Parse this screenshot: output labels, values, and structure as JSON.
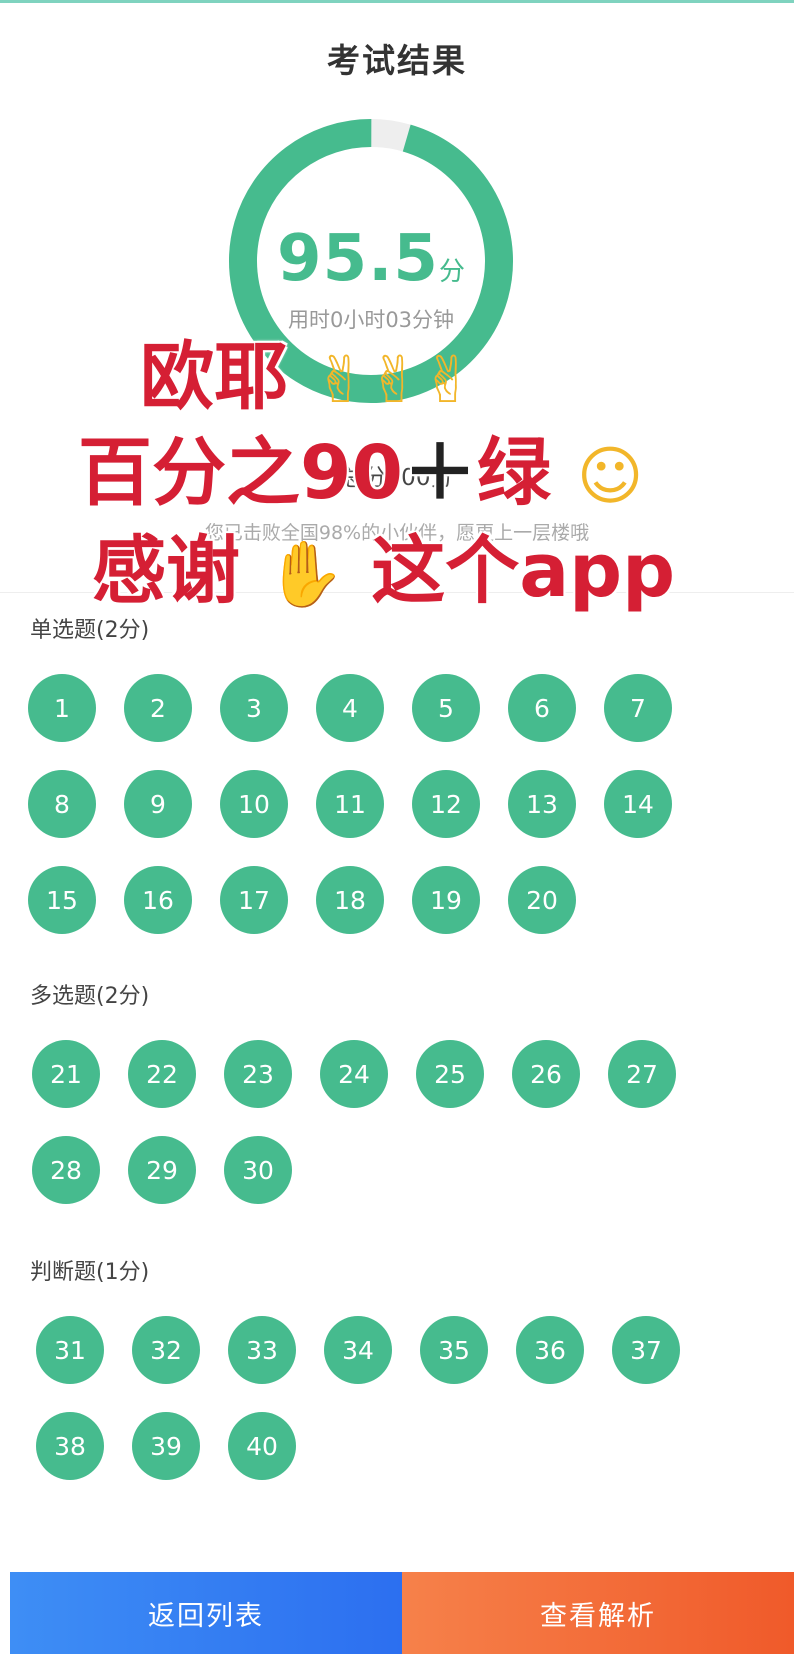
{
  "header": {
    "title": "考试结果"
  },
  "result": {
    "score": "95.5",
    "score_unit": "分",
    "time_used": "用时0小时03分钟",
    "total_score": "总分100分",
    "beat_text": "您已击败全国98%的小伙伴，愿更上一层楼哦",
    "progress": 0.955
  },
  "overlay": {
    "line1": "欧耶",
    "line2": "百分之90",
    "line2_tail": "绿",
    "line3": "感谢",
    "line3_tail": "这个app",
    "emoji_victory": "victory-hand-emoji",
    "emoji_wink": "winking-face-emoji",
    "emoji_pray": "praying-hands-emoji"
  },
  "sections": [
    {
      "title": "单选题(2分)",
      "questions": [
        "1",
        "2",
        "3",
        "4",
        "5",
        "6",
        "7",
        "8",
        "9",
        "10",
        "11",
        "12",
        "13",
        "14",
        "15",
        "16",
        "17",
        "18",
        "19",
        "20"
      ]
    },
    {
      "title": "多选题(2分)",
      "questions": [
        "21",
        "22",
        "23",
        "24",
        "25",
        "26",
        "27",
        "28",
        "29",
        "30"
      ]
    },
    {
      "title": "判断题(1分)",
      "questions": [
        "31",
        "32",
        "33",
        "34",
        "35",
        "36",
        "37",
        "38",
        "39",
        "40"
      ]
    }
  ],
  "footer": {
    "back_label": "返回列表",
    "analysis_label": "查看解析"
  },
  "colors": {
    "correct": "#46bb8e",
    "back_button": "#3e8ef5",
    "analysis_button": "#f46b38"
  }
}
